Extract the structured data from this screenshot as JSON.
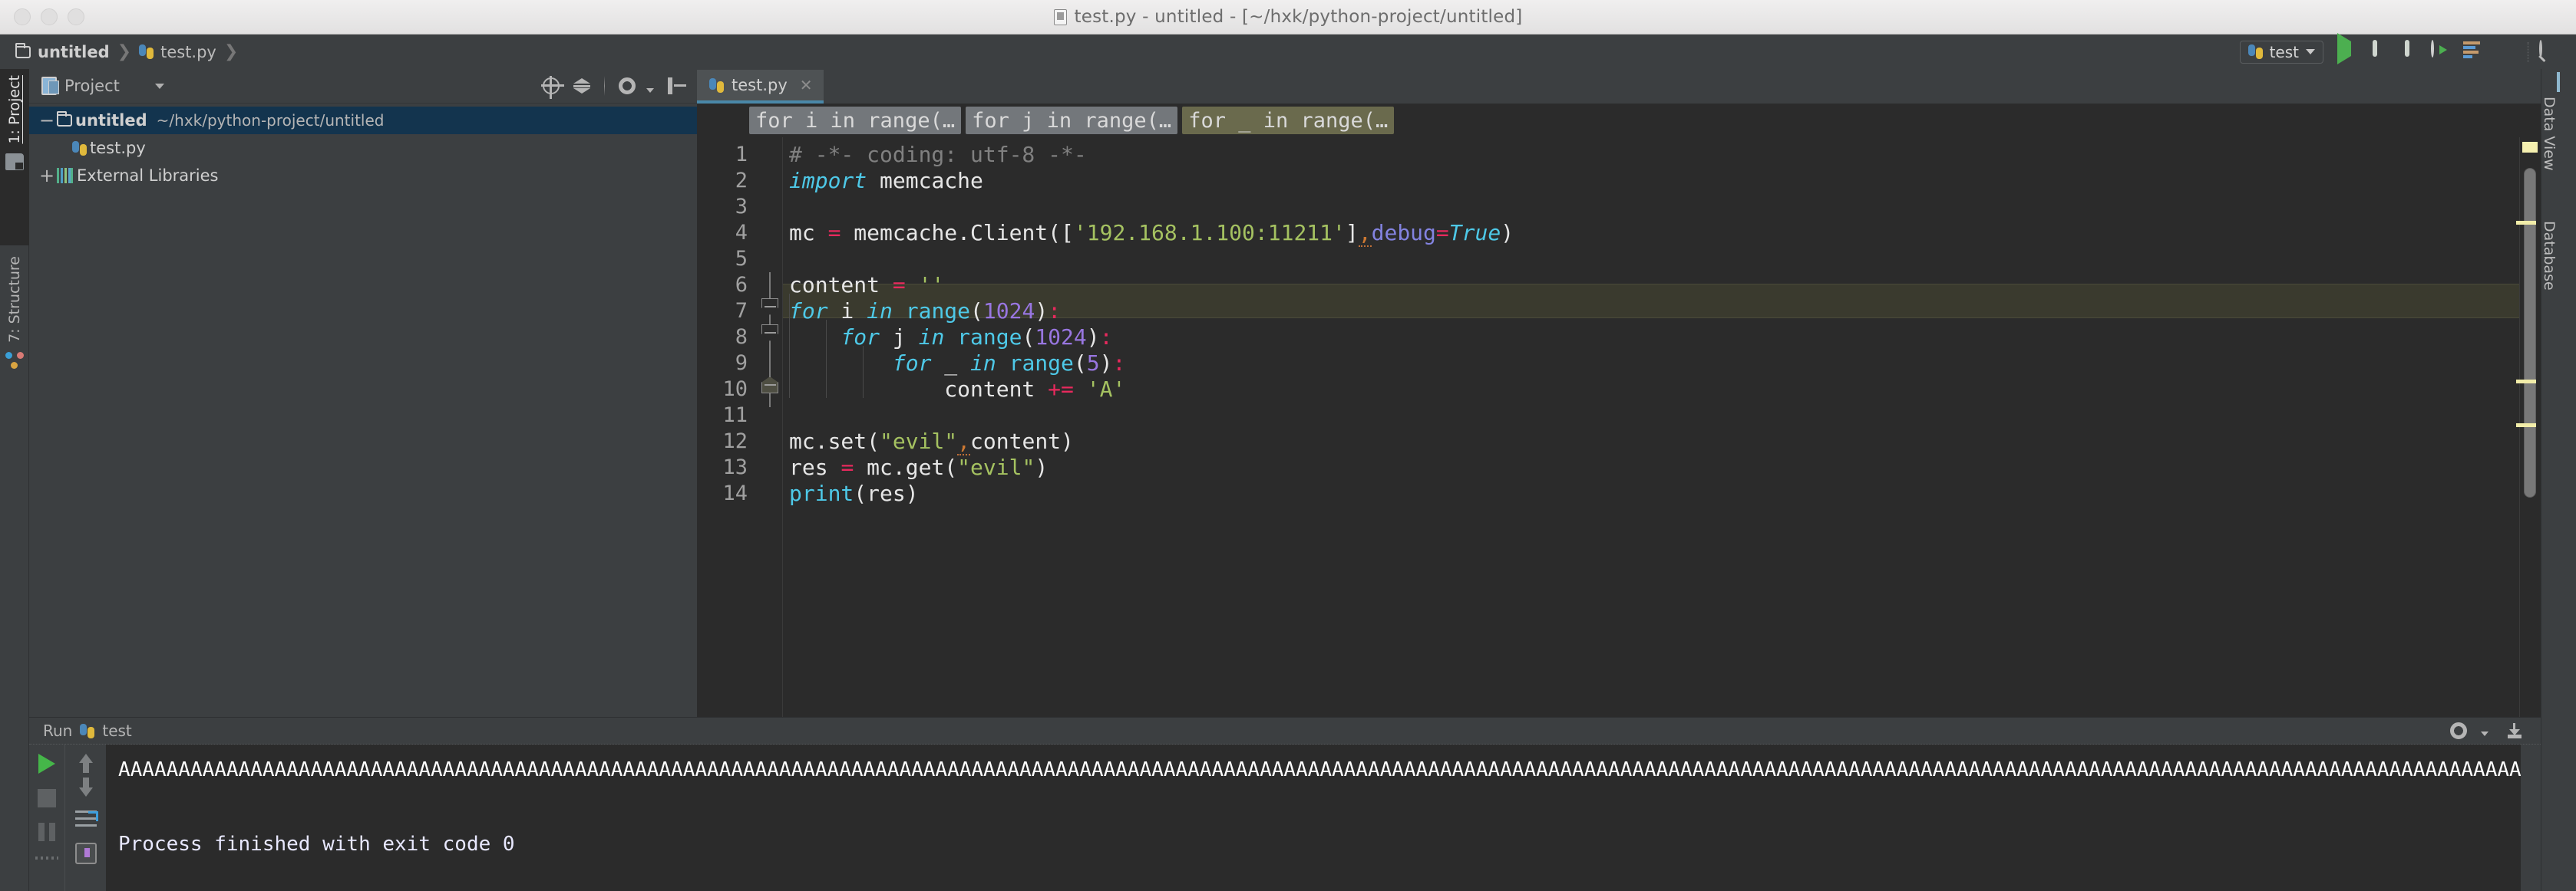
{
  "window": {
    "title": "test.py - untitled - [~/hxk/python-project/untitled]",
    "file_icon": "python-file-icon"
  },
  "navbar": {
    "breadcrumbs": [
      {
        "label": "untitled",
        "icon": "folder-icon"
      },
      {
        "label": "test.py",
        "icon": "python-icon"
      }
    ],
    "run_config": {
      "label": "test",
      "icon": "python-icon",
      "caret": "▾"
    },
    "actions": [
      {
        "name": "run-button",
        "icon": "play-icon"
      },
      {
        "name": "debug-button",
        "icon": "bug-icon"
      },
      {
        "name": "run-coverage-button",
        "icon": "coverage-icon"
      },
      {
        "name": "profile-button",
        "icon": "clock-run-icon"
      },
      {
        "name": "run-with-profiler-button",
        "icon": "bars-run-icon"
      },
      {
        "name": "stop-button",
        "icon": "stop-icon"
      },
      {
        "name": "search-everywhere-button",
        "icon": "magnifier-icon"
      }
    ]
  },
  "left_tool_window_bar": {
    "tabs": [
      {
        "label": "1: Project",
        "icon": "project-icon",
        "active": true
      },
      {
        "label": "7: Structure",
        "icon": "structure-icon",
        "active": false
      }
    ]
  },
  "right_tool_window_bar": {
    "tabs": [
      {
        "label": "Data View",
        "icon": "grid-icon"
      },
      {
        "label": "Database",
        "icon": "database-icon"
      }
    ]
  },
  "project_panel": {
    "title": "Project",
    "title_caret": "▾",
    "toolbar": [
      {
        "name": "locate-file-icon"
      },
      {
        "name": "collapse-all-icon"
      },
      {
        "name": "settings-gear-icon"
      },
      {
        "name": "hide-panel-icon"
      }
    ],
    "tree": [
      {
        "twisty": "−",
        "icon": "folder-icon",
        "label": "untitled",
        "path": "~/hxk/python-project/untitled",
        "selected": true,
        "depth": 0
      },
      {
        "twisty": "",
        "icon": "python-icon",
        "label": "test.py",
        "path": "",
        "selected": false,
        "depth": 1
      },
      {
        "twisty": "+",
        "icon": "libraries-icon",
        "label": "External Libraries",
        "path": "",
        "selected": false,
        "depth": 0
      }
    ]
  },
  "editor": {
    "tabs": [
      {
        "label": "test.py",
        "icon": "python-icon",
        "close": "✕",
        "active": true
      }
    ],
    "sticky_lines": [
      {
        "text": "for i in range(…",
        "current": false
      },
      {
        "text": "for j in range(…",
        "current": false
      },
      {
        "text": "for _ in range(…",
        "current": true
      }
    ],
    "current_line": 10,
    "lines": [
      {
        "num": 1,
        "text": "# -*- coding: utf-8 -*-"
      },
      {
        "num": 2,
        "text": "import memcache"
      },
      {
        "num": 3,
        "text": ""
      },
      {
        "num": 4,
        "text": "mc = memcache.Client(['192.168.1.100:11211'],debug=True)"
      },
      {
        "num": 5,
        "text": ""
      },
      {
        "num": 6,
        "text": "content = ''"
      },
      {
        "num": 7,
        "text": "for i in range(1024):"
      },
      {
        "num": 8,
        "text": "    for j in range(1024):"
      },
      {
        "num": 9,
        "text": "        for _ in range(5):"
      },
      {
        "num": 10,
        "text": "            content += 'A'"
      },
      {
        "num": 11,
        "text": ""
      },
      {
        "num": 12,
        "text": "mc.set(\"evil\",content)"
      },
      {
        "num": 13,
        "text": "res = mc.get(\"evil\")"
      },
      {
        "num": 14,
        "text": "print(res)"
      }
    ]
  },
  "run_panel": {
    "label": "Run",
    "config_name": "test",
    "config_icon": "python-icon",
    "toolbar_left": [
      {
        "name": "rerun-button",
        "icon": "play-icon"
      },
      {
        "name": "stop-process-button",
        "icon": "stop-icon"
      },
      {
        "name": "pause-output-button",
        "icon": "pause-icon"
      }
    ],
    "toolbar_second": [
      {
        "name": "up-stack-trace-button",
        "icon": "arrow-up-icon"
      },
      {
        "name": "down-stack-trace-button",
        "icon": "arrow-down-icon"
      },
      {
        "name": "soft-wrap-button",
        "icon": "wrap-icon"
      },
      {
        "name": "print-button",
        "icon": "print-icon"
      }
    ],
    "header_tools": [
      {
        "name": "settings-gear-icon"
      },
      {
        "name": "hide-panel-icon"
      }
    ],
    "output": [
      {
        "text": "AAAAAAAAAAAAAAAAAAAAAAAAAAAAAAAAAAAAAAAAAAAAAAAAAAAAAAAAAAAAAAAAAAAAAAAAAAAAAAAAAAAAAAAAAAAAAAAAAAAAAAAAAAAAAAAAAAAAAAAAAAAAAAAAAAAAAAAAAAAAAAAAAAAAAAAAAAAAAAAAAAAAAAAAAAAAAAAAAAAAAAAAAAAAAAAAAAAAAAAAAAAAAAAAAAAAAAAAAAAAAAAAAAAAAAAAAAAAAAAAAAAAAAAAAAAAAAAAAAAAAAAAAAAAAAAAAAAAAAAAAAAAAAAAAAAAAAAAAAAAAAAAAAAAAAAAAAAAAAAAAAAAAAAAAAAAAAAAAAAAAAAAAAAAAAAAAAAAAAAAAAAAAAAAAAAAAAAAAAAAAAAAAAAAAAAAAAAAAAAAAAAAAAA"
      },
      {
        "text": "Process finished with exit code 0"
      }
    ]
  },
  "colors": {
    "ide_bg": "#3c3f41",
    "editor_bg": "#2b2b2b",
    "selection_blue": "#13344e",
    "current_line": "#3a3a2e",
    "tab_underline": "#4a88a8",
    "keyword": "#4ec9e8",
    "string": "#a5c261",
    "number": "#9876e0",
    "operator": "#e8295d",
    "comment": "#808080",
    "named_param": "#8383e0",
    "run_green": "#45b649",
    "warn_marker": "#f2eda9"
  }
}
